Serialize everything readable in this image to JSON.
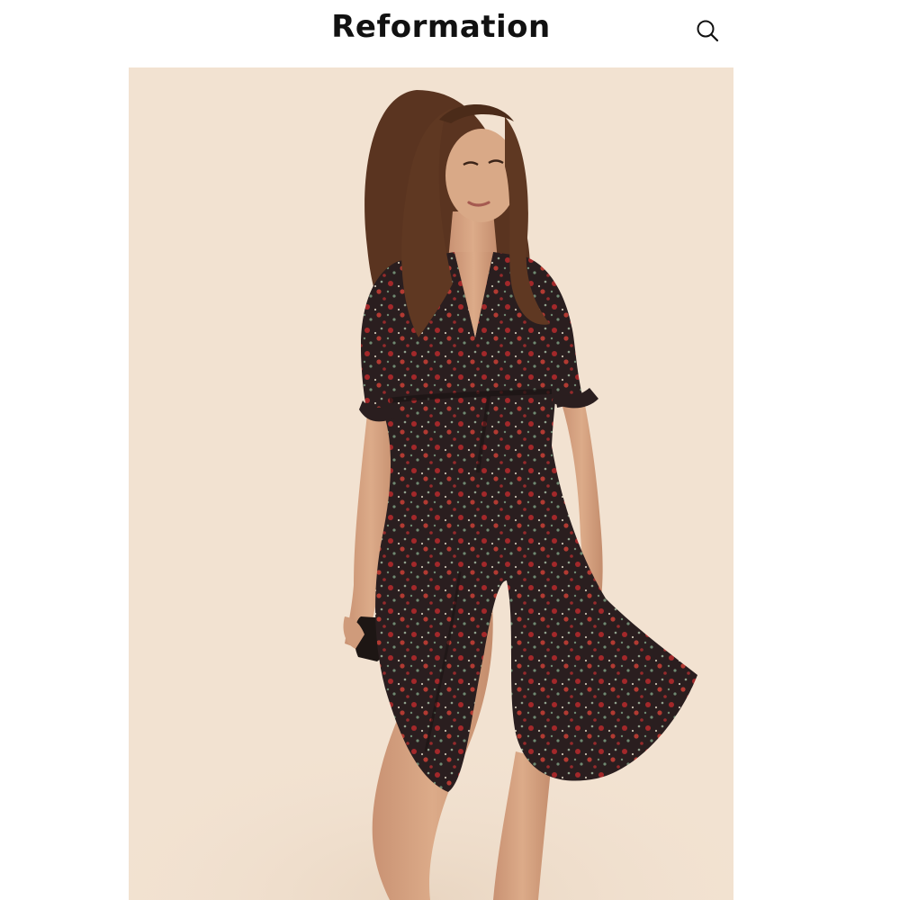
{
  "header": {
    "brand": "Reformation",
    "search_icon": "search-icon"
  },
  "hero": {
    "photo": "model-in-floral-wrap-dress",
    "colors": {
      "backdrop": "#f2e2d1",
      "dress": "#2a1e1f",
      "print_red": "#a3282a",
      "print_green": "#6f8a72",
      "skin": "#d7a582",
      "hair": "#5a3420"
    }
  }
}
